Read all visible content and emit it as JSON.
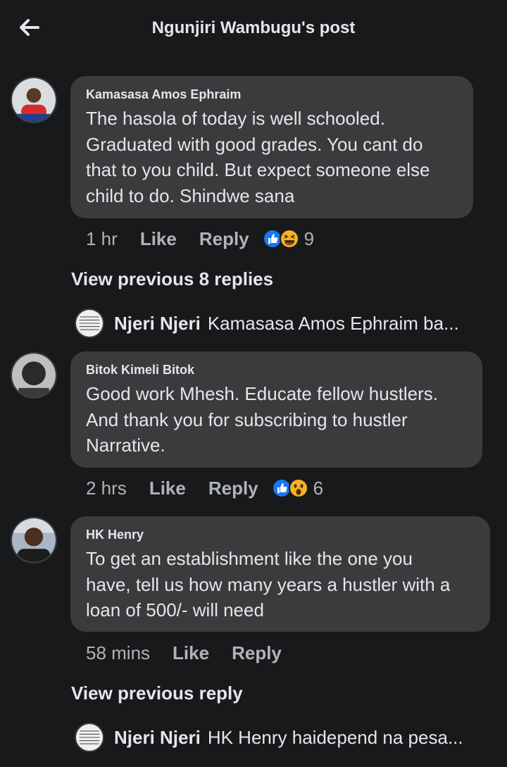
{
  "header": {
    "title": "Ngunjiri Wambugu's post",
    "back_icon": "arrow-left-icon"
  },
  "comments": [
    {
      "author": "Kamasasa Amos Ephraim",
      "lines": [
        "The hasola of today is well schooled.",
        "Graduated with good grades. You cant do",
        "that to you child. But expect someone else",
        "child to do. Shindwe sana"
      ],
      "time": "1 hr",
      "like": "Like",
      "reply": "Reply",
      "reactions": [
        "like-icon",
        "laugh-icon"
      ],
      "reaction_count": "9"
    },
    {
      "author": "Bitok Kimeli Bitok",
      "lines": [
        "Good work Mhesh. Educate fellow hustlers.",
        "And thank you for subscribing to hustler",
        "Narrative."
      ],
      "time": "2 hrs",
      "like": "Like",
      "reply": "Reply",
      "reactions": [
        "like-icon",
        "wow-icon"
      ],
      "reaction_count": "6"
    },
    {
      "author": "HK Henry",
      "lines": [
        "To get an establishment like the one you",
        "have, tell us how many years a hustler with a",
        "loan of 500/- will need"
      ],
      "time": "58 mins",
      "like": "Like",
      "reply": "Reply"
    }
  ],
  "threads": [
    {
      "view_previous": "View previous 8 replies",
      "reply_author": "Njeri Njeri",
      "reply_text": "Kamasasa Amos Ephraim ba..."
    },
    {
      "view_previous": "View previous reply",
      "reply_author": "Njeri Njeri",
      "reply_text": "HK Henry haidepend na pesa..."
    }
  ],
  "colors": {
    "background": "#18191a",
    "bubble": "#3a3b3c",
    "text": "#e4e6eb",
    "muted": "#b0b3b8",
    "like_blue": "#1877f2",
    "emoji_yellow": "#f7b125"
  }
}
